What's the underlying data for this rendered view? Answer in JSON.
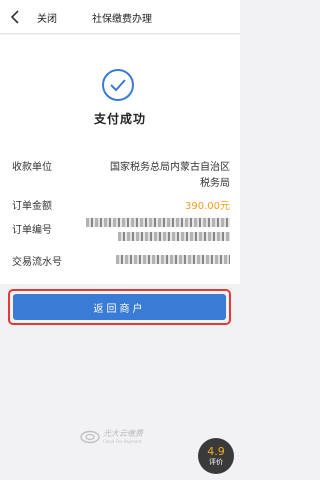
{
  "nav": {
    "back_icon": "chevron-left-icon",
    "close_label": "关闭",
    "title": "社保缴费办理"
  },
  "status": {
    "icon": "check-circle-icon",
    "text": "支付成功",
    "icon_color": "#3a7bd5"
  },
  "details": {
    "payee_label": "收款单位",
    "payee_value_line1": "国家税务总局内蒙古自治区",
    "payee_value_line2": "税务局",
    "amount_label": "订单金额",
    "amount_value": "390.00元",
    "amount_color": "#f0a020",
    "order_no_label": "订单编号",
    "serial_no_label": "交易流水号"
  },
  "actions": {
    "return_label": "返回商户",
    "button_color": "#3a7bd5",
    "highlight_color": "#e53935"
  },
  "footer": {
    "logo_name": "光大云缴费",
    "logo_en": "Cloud Fee Payment"
  },
  "rating": {
    "score": "4.9",
    "label": "评价"
  }
}
